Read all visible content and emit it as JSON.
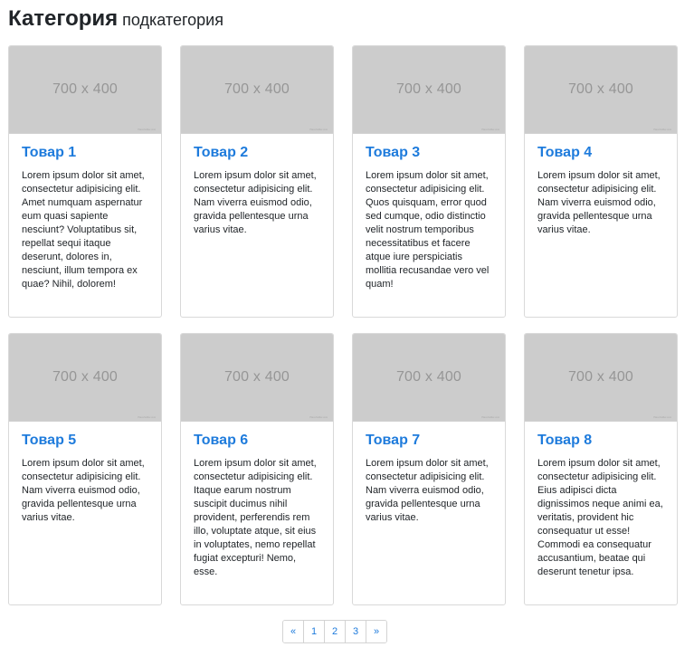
{
  "header": {
    "title": "Категория",
    "subtitle": "подкатегория"
  },
  "placeholder": {
    "label": "700 x 400",
    "credit": "Placeholder.com"
  },
  "products": [
    {
      "title": "Товар 1",
      "text": "Lorem ipsum dolor sit amet, consectetur adipisicing elit. Amet numquam aspernatur eum quasi sapiente nesciunt? Voluptatibus sit, repellat sequi itaque deserunt, dolores in, nesciunt, illum tempora ex quae? Nihil, dolorem!"
    },
    {
      "title": "Товар 2",
      "text": "Lorem ipsum dolor sit amet, consectetur adipisicing elit. Nam viverra euismod odio, gravida pellentesque urna varius vitae."
    },
    {
      "title": "Товар 3",
      "text": "Lorem ipsum dolor sit amet, consectetur adipisicing elit. Quos quisquam, error quod sed cumque, odio distinctio velit nostrum temporibus necessitatibus et facere atque iure perspiciatis mollitia recusandae vero vel quam!"
    },
    {
      "title": "Товар 4",
      "text": "Lorem ipsum dolor sit amet, consectetur adipisicing elit. Nam viverra euismod odio, gravida pellentesque urna varius vitae."
    },
    {
      "title": "Товар 5",
      "text": "Lorem ipsum dolor sit amet, consectetur adipisicing elit. Nam viverra euismod odio, gravida pellentesque urna varius vitae."
    },
    {
      "title": "Товар 6",
      "text": "Lorem ipsum dolor sit amet, consectetur adipisicing elit. Itaque earum nostrum suscipit ducimus nihil provident, perferendis rem illo, voluptate atque, sit eius in voluptates, nemo repellat fugiat excepturi! Nemo, esse."
    },
    {
      "title": "Товар 7",
      "text": "Lorem ipsum dolor sit amet, consectetur adipisicing elit. Nam viverra euismod odio, gravida pellentesque urna varius vitae."
    },
    {
      "title": "Товар 8",
      "text": "Lorem ipsum dolor sit amet, consectetur adipisicing elit. Eius adipisci dicta dignissimos neque animi ea, veritatis, provident hic consequatur ut esse! Commodi ea consequatur accusantium, beatae qui deserunt tenetur ipsa."
    }
  ],
  "pagination": {
    "prev": "«",
    "pages": [
      "1",
      "2",
      "3"
    ],
    "next": "»"
  },
  "colors": {
    "link": "#1e7bdc",
    "placeholder_bg": "#cccccc",
    "placeholder_text": "#969696",
    "border": "#d9d9d9"
  }
}
